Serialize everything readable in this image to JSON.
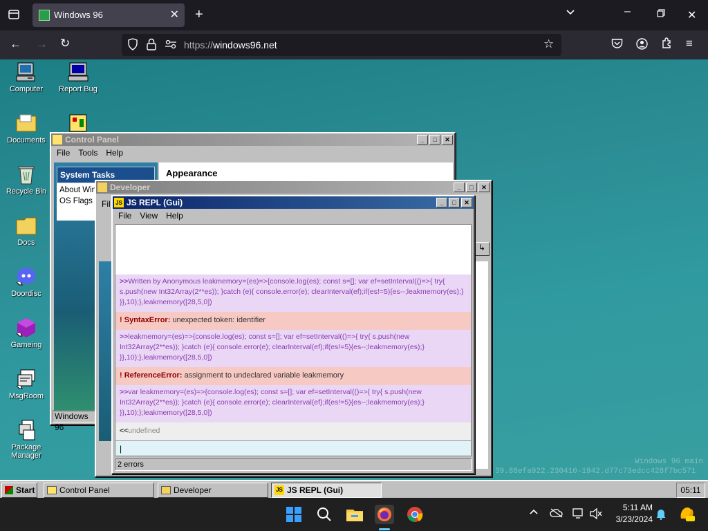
{
  "browser": {
    "tab_title": "Windows 96",
    "url_scheme": "https://",
    "url_host": "windows96.net"
  },
  "desktop_icons": [
    {
      "label": "Computer"
    },
    {
      "label": "Report Bug"
    },
    {
      "label": "Documents"
    },
    {
      "label": "Recycle Bin"
    },
    {
      "label": "Docs"
    },
    {
      "label": "Doordisc"
    },
    {
      "label": "Gameing"
    },
    {
      "label": "MsgRoom"
    },
    {
      "label": "Package Manager"
    }
  ],
  "watermark": {
    "line1": "Windows 96 main",
    "line2": "39.88efa922.230410-1942.d77c73edcc428f7bc571"
  },
  "control_panel": {
    "title": "Control Panel",
    "menu": [
      "File",
      "Tools",
      "Help"
    ],
    "system_tasks": "System Tasks",
    "links": [
      "About Win",
      "OS Flags"
    ],
    "heading": "Appearance",
    "status": "Windows 96"
  },
  "developer": {
    "title": "Developer",
    "menu_first": "Fil"
  },
  "repl": {
    "title": "JS REPL (Gui)",
    "menu": [
      "File",
      "View",
      "Help"
    ],
    "entries": [
      {
        "kind": "in",
        "prefix": ">>",
        "text": "Written by Anonymous leakmemory=(es)=>{console.log(es);     const s=[];     var ef=setInterval(()=>{ try{     s.push(new Int32Array(2**es));    }catch (e){    console.error(e);    clearInterval(ef);if(es!=5){es--;leakmemory(es);} }},10);},leakmemory([28,5,0])"
      },
      {
        "kind": "err",
        "name": "SyntaxError:",
        "text": "unexpected token: identifier"
      },
      {
        "kind": "in",
        "prefix": ">>",
        "text": "leakmemory=(es)=>{console.log(es);     const s=[];     var ef=setInterval(()=>{ try{       s.push(new Int32Array(2**es));    }catch (e){    console.error(e);    clearInterval(ef);if(es!=5){es--;leakmemory(es);} }},10);},leakmemory([28,5,0])"
      },
      {
        "kind": "err",
        "name": "ReferenceError:",
        "text": "assignment to undeclared variable leakmemory"
      },
      {
        "kind": "in",
        "prefix": ">>",
        "text": "var leakmemory=(es)=>{console.log(es);     const s=[];     var ef=setInterval(()=>{ try{       s.push(new Int32Array(2**es));    }catch (e){    console.error(e);    clearInterval(ef);if(es!=5){es--;leakmemory(es);} }},10);};leakmemory([28,5,0])"
      },
      {
        "kind": "out",
        "prefix": "<<",
        "text": "undefined"
      }
    ],
    "status": "2 errors"
  },
  "w96_taskbar": {
    "start": "Start",
    "items": [
      "Control Panel",
      "Developer",
      "JS REPL (Gui)"
    ],
    "clock": "05:11"
  },
  "os_taskbar": {
    "time": "5:11 AM",
    "date": "3/23/2024"
  },
  "colors": {
    "titlebar_active": "#0a246a",
    "repl_input_bg": "#ead7f5",
    "repl_error_bg": "#f6c9c3",
    "desktop": "#2c8d95"
  }
}
